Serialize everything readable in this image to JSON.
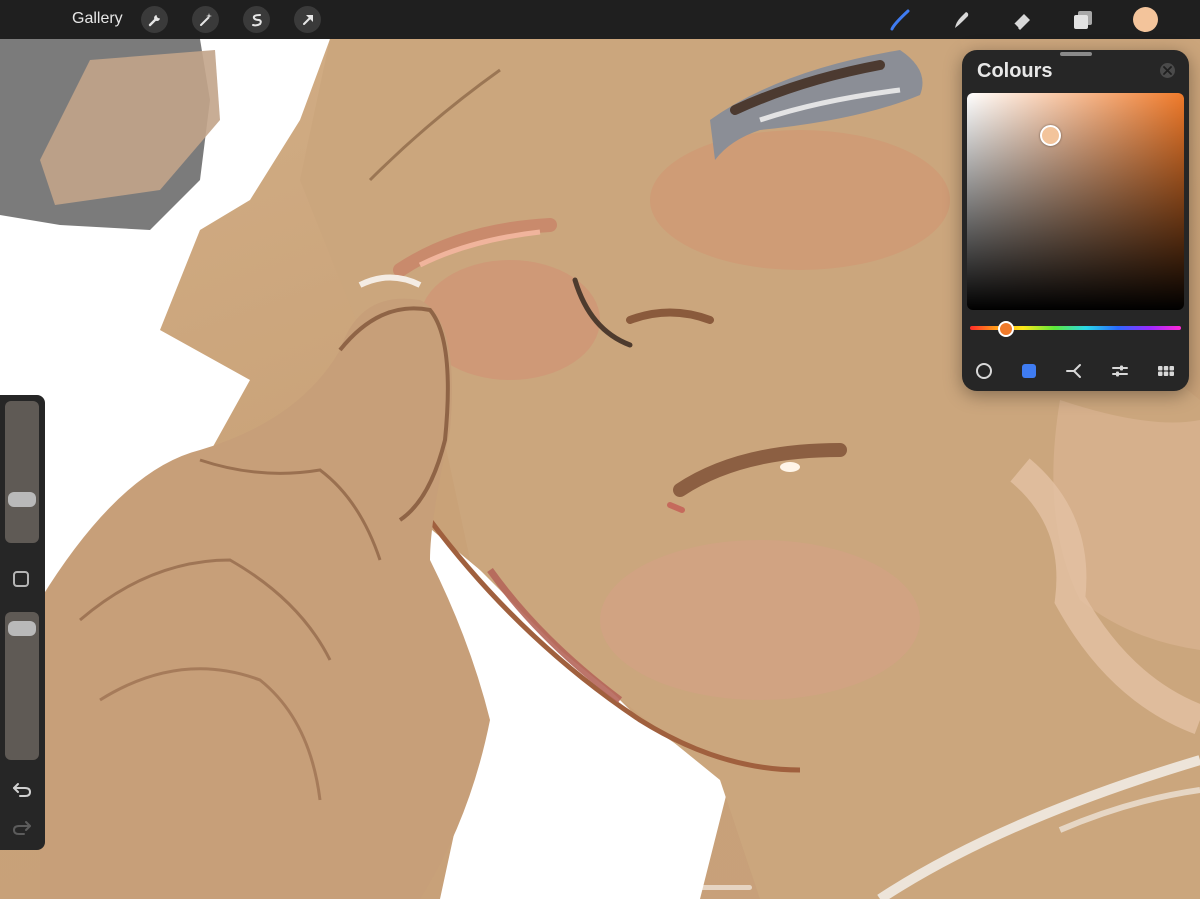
{
  "topbar": {
    "gallery_label": "Gallery",
    "left_tools": [
      "wrench-icon",
      "magic-wand-icon",
      "selection-icon",
      "transform-arrow-icon"
    ],
    "right_tools": [
      "brush-icon",
      "smudge-icon",
      "eraser-icon",
      "layers-icon"
    ],
    "active_tool_color": "#3f7cf2",
    "current_colour": "#f3c49b"
  },
  "sidebar": {
    "brush_size_level": 0.27,
    "opacity_level": 0.95,
    "icons": [
      "modify-square-icon",
      "undo-icon",
      "redo-icon"
    ]
  },
  "colours_panel": {
    "title": "Colours",
    "selected_colour": "#f3c49b",
    "hue_colour": "#f07a2a",
    "hue_position": 0.16,
    "modes": [
      "disc-icon",
      "classic-icon",
      "harmony-icon",
      "value-icon",
      "palettes-icon"
    ],
    "active_mode": "classic-icon",
    "active_mode_color": "#3f7cf2"
  }
}
